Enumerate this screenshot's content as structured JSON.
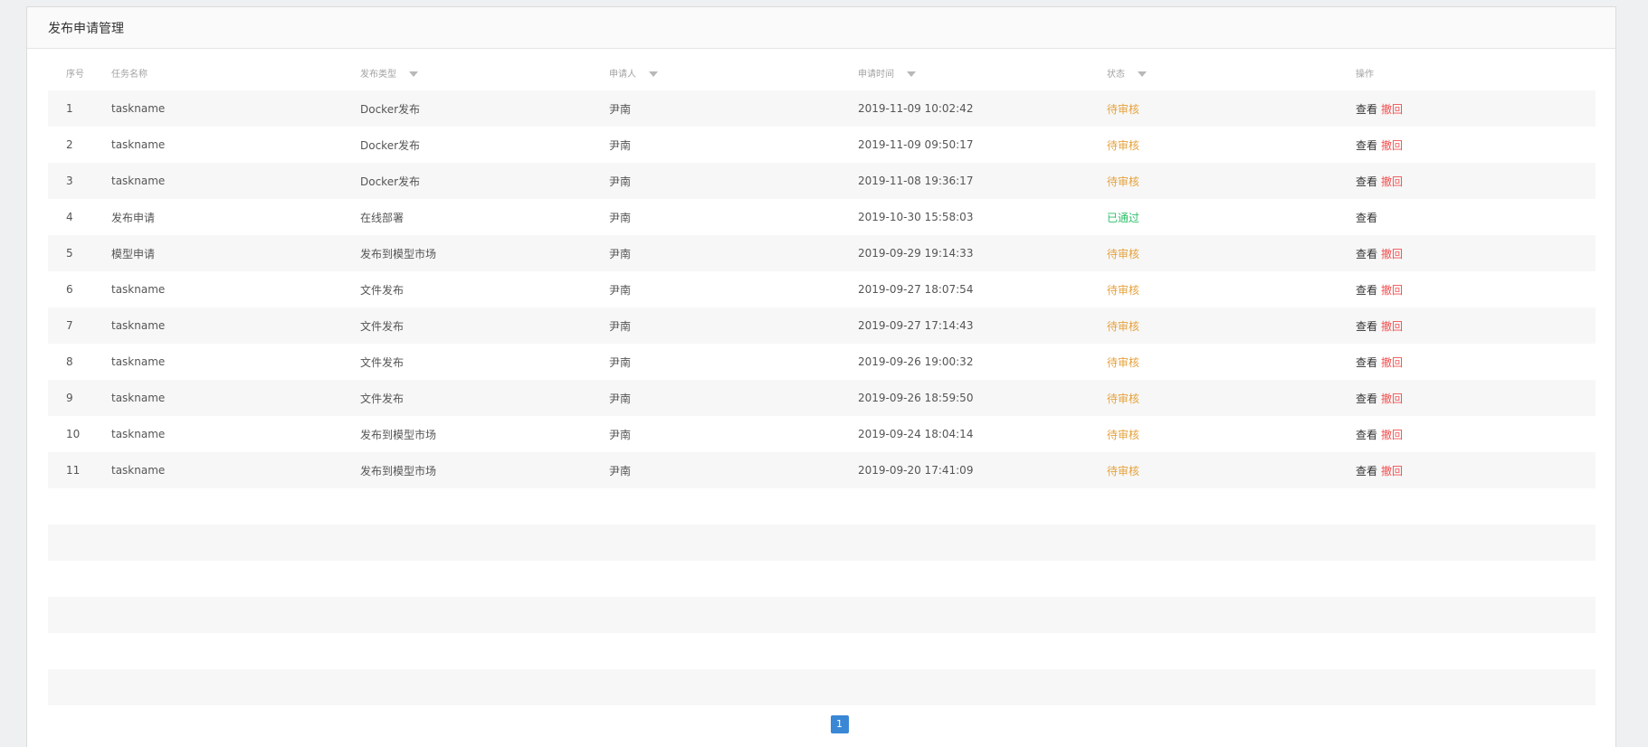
{
  "panel": {
    "title": "发布申请管理"
  },
  "table": {
    "columns": [
      "序号",
      "任务名称",
      "发布类型",
      "申请人",
      "申请时间",
      "状态",
      "操作"
    ],
    "rows": [
      {
        "index": "1",
        "name": "taskname",
        "type": "Docker发布",
        "applicant": "尹南",
        "time": "2019-11-09 10:02:42",
        "status": "待审核",
        "status_kind": "pending",
        "view": "查看",
        "revoke": "撤回"
      },
      {
        "index": "2",
        "name": "taskname",
        "type": "Docker发布",
        "applicant": "尹南",
        "time": "2019-11-09 09:50:17",
        "status": "待审核",
        "status_kind": "pending",
        "view": "查看",
        "revoke": "撤回"
      },
      {
        "index": "3",
        "name": "taskname",
        "type": "Docker发布",
        "applicant": "尹南",
        "time": "2019-11-08 19:36:17",
        "status": "待审核",
        "status_kind": "pending",
        "view": "查看",
        "revoke": "撤回"
      },
      {
        "index": "4",
        "name": "发布申请",
        "type": "在线部署",
        "applicant": "尹南",
        "time": "2019-10-30 15:58:03",
        "status": "已通过",
        "status_kind": "passed",
        "view": "查看",
        "revoke": ""
      },
      {
        "index": "5",
        "name": "模型申请",
        "type": "发布到模型市场",
        "applicant": "尹南",
        "time": "2019-09-29 19:14:33",
        "status": "待审核",
        "status_kind": "pending",
        "view": "查看",
        "revoke": "撤回"
      },
      {
        "index": "6",
        "name": "taskname",
        "type": "文件发布",
        "applicant": "尹南",
        "time": "2019-09-27 18:07:54",
        "status": "待审核",
        "status_kind": "pending",
        "view": "查看",
        "revoke": "撤回"
      },
      {
        "index": "7",
        "name": "taskname",
        "type": "文件发布",
        "applicant": "尹南",
        "time": "2019-09-27 17:14:43",
        "status": "待审核",
        "status_kind": "pending",
        "view": "查看",
        "revoke": "撤回"
      },
      {
        "index": "8",
        "name": "taskname",
        "type": "文件发布",
        "applicant": "尹南",
        "time": "2019-09-26 19:00:32",
        "status": "待审核",
        "status_kind": "pending",
        "view": "查看",
        "revoke": "撤回"
      },
      {
        "index": "9",
        "name": "taskname",
        "type": "文件发布",
        "applicant": "尹南",
        "time": "2019-09-26 18:59:50",
        "status": "待审核",
        "status_kind": "pending",
        "view": "查看",
        "revoke": "撤回"
      },
      {
        "index": "10",
        "name": "taskname",
        "type": "发布到模型市场",
        "applicant": "尹南",
        "time": "2019-09-24 18:04:14",
        "status": "待审核",
        "status_kind": "pending",
        "view": "查看",
        "revoke": "撤回"
      },
      {
        "index": "11",
        "name": "taskname",
        "type": "发布到模型市场",
        "applicant": "尹南",
        "time": "2019-09-20 17:41:09",
        "status": "待审核",
        "status_kind": "pending",
        "view": "查看",
        "revoke": "撤回"
      }
    ],
    "empty_rows": 6
  },
  "pagination": {
    "current": "1"
  },
  "colors": {
    "pending": "#e6a23c",
    "passed": "#2fbf6a",
    "revoke": "#f05050",
    "accent": "#3a87d6"
  }
}
